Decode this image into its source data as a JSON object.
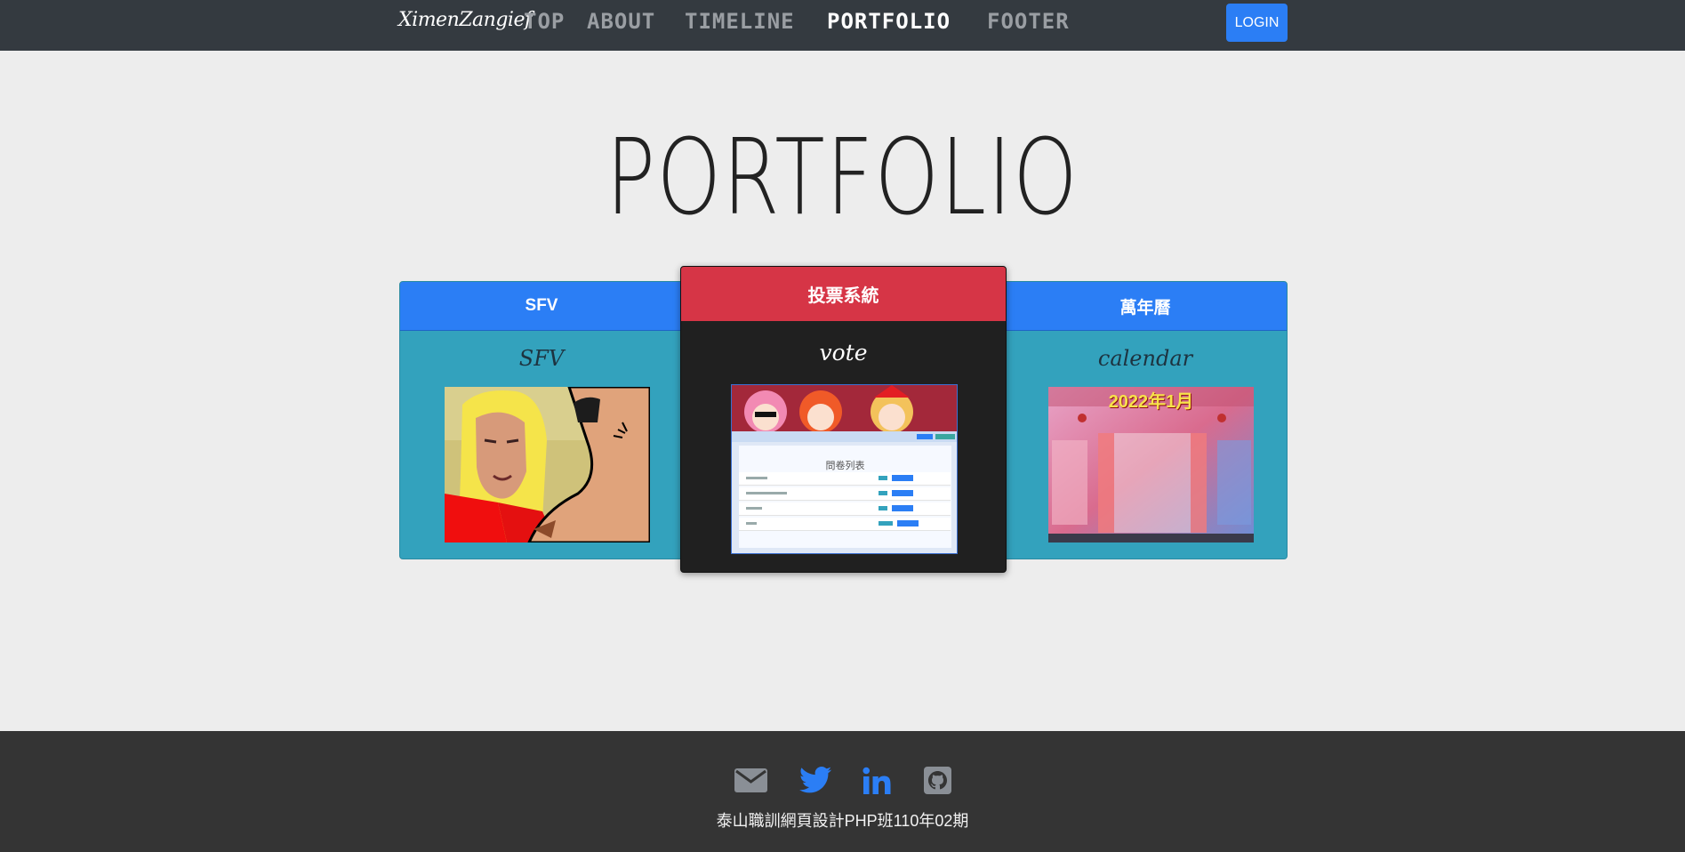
{
  "navbar": {
    "brand": "XimenZangief",
    "links": [
      "TOP",
      "ABOUT",
      "TIMELINE",
      "PORTFOLIO",
      "FOOTER"
    ],
    "active_link": "PORTFOLIO",
    "login_label": "LOGIN"
  },
  "portfolio": {
    "title": "PORTFOLIO",
    "cards": [
      {
        "header": "SFV",
        "subtitle": "SFV",
        "header_color": "#2b7ef5",
        "thumb_icon": "street-fighter-meme-image"
      },
      {
        "header": "投票系統",
        "subtitle": "vote",
        "header_color": "#d63546",
        "thumb_icon": "vote-system-screenshot",
        "thumb_heading": "問卷列表"
      },
      {
        "header": "萬年曆",
        "subtitle": "calendar",
        "header_color": "#2b7ef5",
        "thumb_icon": "calendar-screenshot",
        "thumb_heading": "2022年1月"
      }
    ]
  },
  "footer": {
    "icons": [
      "envelope-icon",
      "twitter-icon",
      "linkedin-icon",
      "github-icon"
    ],
    "text": "泰山職訓網頁設計PHP班110年02期"
  },
  "colors": {
    "navbar_bg": "#343a40",
    "page_bg": "#ededed",
    "primary": "#2b7ef5",
    "danger": "#d63546",
    "info": "#33a2bd",
    "footer_bg": "#343434"
  }
}
